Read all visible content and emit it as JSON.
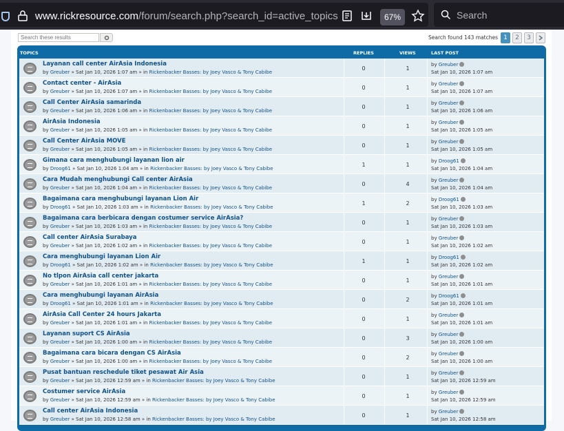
{
  "browser": {
    "url_host": "www.rickresource.com",
    "url_path": "/forum/search.php?search_id=active_topics&sid=",
    "zoom": "67%",
    "search_placeholder": "Search"
  },
  "search": {
    "placeholder": "Search these results",
    "found": "Search found 143 matches"
  },
  "pagination": [
    "1",
    "2",
    "3"
  ],
  "columns": {
    "topics": "TOPICS",
    "replies": "REPLIES",
    "views": "VIEWS",
    "last_post": "LAST POST"
  },
  "rows": [
    {
      "title": "Layanan call center AirAsia Indonesia",
      "user": "Greuber",
      "date": "Sat Jan 10, 2026 1:07 am",
      "forum": "Rickenbacker Basses: by Joey Vasco & Tony Cabibe",
      "replies": "0",
      "views": "1",
      "last_user": "Greuber",
      "last_date": "Sat Jan 10, 2026 1:07 am"
    },
    {
      "title": "Contact center - AirAsia",
      "user": "Greuber",
      "date": "Sat Jan 10, 2026 1:07 am",
      "forum": "Rickenbacker Basses: by Joey Vasco & Tony Cabibe",
      "replies": "0",
      "views": "1",
      "last_user": "Greuber",
      "last_date": "Sat Jan 10, 2026 1:07 am"
    },
    {
      "title": "Call Center AirAsia samarinda",
      "user": "Greuber",
      "date": "Sat Jan 10, 2026 1:06 am",
      "forum": "Rickenbacker Basses: by Joey Vasco & Tony Cabibe",
      "replies": "0",
      "views": "1",
      "last_user": "Greuber",
      "last_date": "Sat Jan 10, 2026 1:06 am"
    },
    {
      "title": "AirAsia Indonesia",
      "user": "Greuber",
      "date": "Sat Jan 10, 2026 1:05 am",
      "forum": "Rickenbacker Basses: by Joey Vasco & Tony Cabibe",
      "replies": "0",
      "views": "1",
      "last_user": "Greuber",
      "last_date": "Sat Jan 10, 2026 1:05 am"
    },
    {
      "title": "Call Center AirAsia MOVE",
      "user": "Greuber",
      "date": "Sat Jan 10, 2026 1:05 am",
      "forum": "Rickenbacker Basses: by Joey Vasco & Tony Cabibe",
      "replies": "0",
      "views": "1",
      "last_user": "Greuber",
      "last_date": "Sat Jan 10, 2026 1:05 am"
    },
    {
      "title": "Gimana cara menghubungi layanan lion air",
      "user": "Droog61",
      "date": "Sat Jan 10, 2026 1:04 am",
      "forum": "Rickenbacker Basses: by Joey Vasco & Tony Cabibe",
      "replies": "1",
      "views": "1",
      "last_user": "Droog61",
      "last_date": "Sat Jan 10, 2026 1:04 am"
    },
    {
      "title": "Cara Mudah menghubungi Call center AirAsia",
      "user": "Greuber",
      "date": "Sat Jan 10, 2026 1:04 am",
      "forum": "Rickenbacker Basses: by Joey Vasco & Tony Cabibe",
      "replies": "0",
      "views": "4",
      "last_user": "Greuber",
      "last_date": "Sat Jan 10, 2026 1:04 am"
    },
    {
      "title": "Bagaimana cara menghubungi layanan Lion Air",
      "user": "Droog61",
      "date": "Sat Jan 10, 2026 1:03 am",
      "forum": "Rickenbacker Basses: by Joey Vasco & Tony Cabibe",
      "replies": "1",
      "views": "2",
      "last_user": "Droog61",
      "last_date": "Sat Jan 10, 2026 1:03 am"
    },
    {
      "title": "Bagaimana cara berbicara dengan costumer service AirAsia?",
      "user": "Greuber",
      "date": "Sat Jan 10, 2026 1:03 am",
      "forum": "Rickenbacker Basses: by Joey Vasco & Tony Cabibe",
      "replies": "0",
      "views": "1",
      "last_user": "Greuber",
      "last_date": "Sat Jan 10, 2026 1:03 am"
    },
    {
      "title": "Call center AirAsia Surabaya",
      "user": "Greuber",
      "date": "Sat Jan 10, 2026 1:02 am",
      "forum": "Rickenbacker Basses: by Joey Vasco & Tony Cabibe",
      "replies": "0",
      "views": "1",
      "last_user": "Greuber",
      "last_date": "Sat Jan 10, 2026 1:02 am"
    },
    {
      "title": "Cara menghubungi layanan Lion Air",
      "user": "Droog61",
      "date": "Sat Jan 10, 2026 1:02 am",
      "forum": "Rickenbacker Basses: by Joey Vasco & Tony Cabibe",
      "replies": "1",
      "views": "1",
      "last_user": "Droog61",
      "last_date": "Sat Jan 10, 2026 1:02 am"
    },
    {
      "title": "No tlpon AirAsia call center jakarta",
      "user": "Greuber",
      "date": "Sat Jan 10, 2026 1:01 am",
      "forum": "Rickenbacker Basses: by Joey Vasco & Tony Cabibe",
      "replies": "0",
      "views": "1",
      "last_user": "Greuber",
      "last_date": "Sat Jan 10, 2026 1:01 am"
    },
    {
      "title": "Cara menghubungi layanan AirAsia",
      "user": "Droog61",
      "date": "Sat Jan 10, 2026 1:01 am",
      "forum": "Rickenbacker Basses: by Joey Vasco & Tony Cabibe",
      "replies": "0",
      "views": "2",
      "last_user": "Droog61",
      "last_date": "Sat Jan 10, 2026 1:01 am"
    },
    {
      "title": "AirAsia Call Center 24 hours Jakarta",
      "user": "Greuber",
      "date": "Sat Jan 10, 2026 1:01 am",
      "forum": "Rickenbacker Basses: by Joey Vasco & Tony Cabibe",
      "replies": "0",
      "views": "1",
      "last_user": "Greuber",
      "last_date": "Sat Jan 10, 2026 1:01 am"
    },
    {
      "title": "Layanan suport CS AirAsia",
      "user": "Greuber",
      "date": "Sat Jan 10, 2026 1:00 am",
      "forum": "Rickenbacker Basses: by Joey Vasco & Tony Cabibe",
      "replies": "0",
      "views": "3",
      "last_user": "Greuber",
      "last_date": "Sat Jan 10, 2026 1:00 am"
    },
    {
      "title": "Bagaimana cara bicara dengan CS AirAsia",
      "user": "Greuber",
      "date": "Sat Jan 10, 2026 1:00 am",
      "forum": "Rickenbacker Basses: by Joey Vasco & Tony Cabibe",
      "replies": "0",
      "views": "2",
      "last_user": "Greuber",
      "last_date": "Sat Jan 10, 2026 1:00 am"
    },
    {
      "title": "Pusat bantuan reschedule tiket pesawat Air Asia",
      "user": "Greuber",
      "date": "Sat Jan 10, 2026 12:59 am",
      "forum": "Rickenbacker Basses: by Joey Vasco & Tony Cabibe",
      "replies": "0",
      "views": "1",
      "last_user": "Greuber",
      "last_date": "Sat Jan 10, 2026 12:59 am"
    },
    {
      "title": "Costumer service AirAsia",
      "user": "Greuber",
      "date": "Sat Jan 10, 2026 12:59 am",
      "forum": "Rickenbacker Basses: by Joey Vasco & Tony Cabibe",
      "replies": "0",
      "views": "1",
      "last_user": "Greuber",
      "last_date": "Sat Jan 10, 2026 12:59 am"
    },
    {
      "title": "Call center AirAsia Indonesia",
      "user": "Greuber",
      "date": "Sat Jan 10, 2026 12:58 am",
      "forum": "Rickenbacker Basses: by Joey Vasco & Tony Cabibe",
      "replies": "0",
      "views": "1",
      "last_user": "Greuber",
      "last_date": "Sat Jan 10, 2026 12:58 am"
    }
  ]
}
